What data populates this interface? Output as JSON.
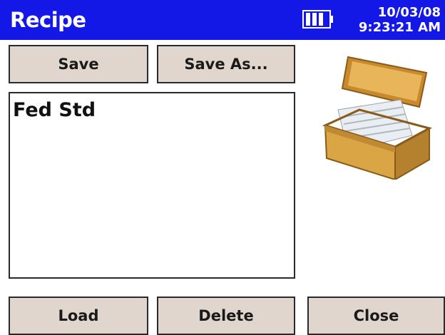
{
  "window": {
    "title": "Recipe",
    "date": "10/03/08",
    "time": "9:23:21 AM"
  },
  "toolbar": {
    "save_label": "Save",
    "save_as_label": "Save As..."
  },
  "recipe_list": {
    "items": [
      "Fed Std"
    ]
  },
  "footer": {
    "load_label": "Load",
    "delete_label": "Delete",
    "close_label": "Close"
  },
  "icons": {
    "battery": "battery-icon",
    "recipe_box": "recipe-card-box-icon"
  },
  "colors": {
    "titlebar": "#1418e6",
    "button_face": "#e1d6cd",
    "wood": "#d9a545"
  }
}
